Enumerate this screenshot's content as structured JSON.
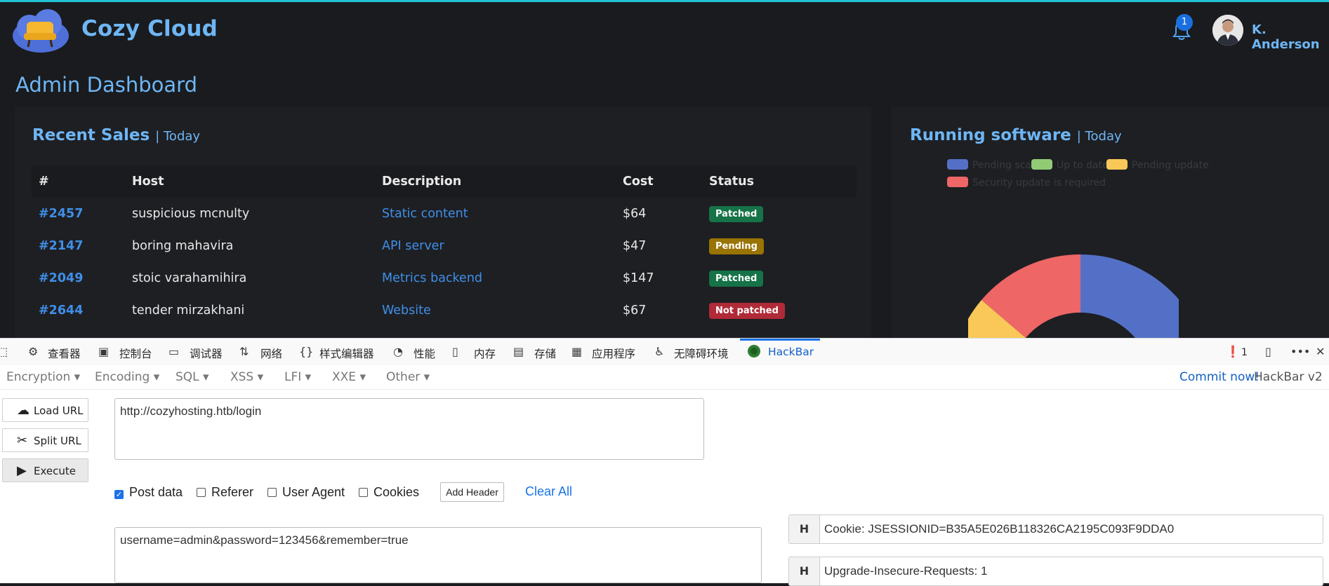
{
  "app": {
    "brand": "Cozy Cloud",
    "notifications_count": "1",
    "user_name": "K. Anderson",
    "page_title": "Admin Dashboard",
    "accent_color": "#6eb6f5"
  },
  "sales": {
    "title": "Recent Sales",
    "period": "| Today",
    "columns": [
      "#",
      "Host",
      "Description",
      "Cost",
      "Status"
    ],
    "rows": [
      {
        "id": "#2457",
        "host": "suspicious mcnulty",
        "desc": "Static content",
        "cost": "$64",
        "status": "Patched",
        "status_color": "#157347"
      },
      {
        "id": "#2147",
        "host": "boring mahavira",
        "desc": "API server",
        "cost": "$47",
        "status": "Pending",
        "status_color": "#997404"
      },
      {
        "id": "#2049",
        "host": "stoic varahamihira",
        "desc": "Metrics backend",
        "cost": "$147",
        "status": "Patched",
        "status_color": "#157347"
      },
      {
        "id": "#2644",
        "host": "tender mirzakhani",
        "desc": "Website",
        "cost": "$67",
        "status": "Not patched",
        "status_color": "#b02a37"
      }
    ]
  },
  "software": {
    "title": "Running software",
    "period": "| Today",
    "legend": [
      {
        "label": "Pending scan",
        "color": "#5470c6"
      },
      {
        "label": "Up to date",
        "color": "#91cc75"
      },
      {
        "label": "Pending update",
        "color": "#fac858"
      },
      {
        "label": "Security update is required",
        "color": "#ee6666"
      }
    ]
  },
  "devtools": {
    "tabs": [
      "查看器",
      "控制台",
      "调试器",
      "网络",
      "样式编辑器",
      "性能",
      "内存",
      "存储",
      "应用程序",
      "无障碍环境",
      "HackBar"
    ],
    "error_count": "1"
  },
  "hackbar": {
    "menus": [
      "Encoding",
      "SQL",
      "XSS",
      "LFI",
      "XXE",
      "Other"
    ],
    "first_menu": "Encryption",
    "commit": "Commit now!",
    "version": "HackBar v2",
    "buttons": {
      "load": "Load URL",
      "split": "Split URL",
      "execute": "Execute"
    },
    "url": "http://cozyhosting.htb/login",
    "options": {
      "post": "Post data",
      "referer": "Referer",
      "ua": "User Agent",
      "cookies": "Cookies"
    },
    "add_header": "Add Header",
    "clear_all": "Clear All",
    "post_body": "username=admin&password=123456&remember=true",
    "headers": [
      {
        "key": "H",
        "value": "Cookie: JSESSIONID=B35A5E026B118326CA2195C093F9DDA0"
      },
      {
        "key": "H",
        "value": "Upgrade-Insecure-Requests: 1"
      }
    ]
  }
}
